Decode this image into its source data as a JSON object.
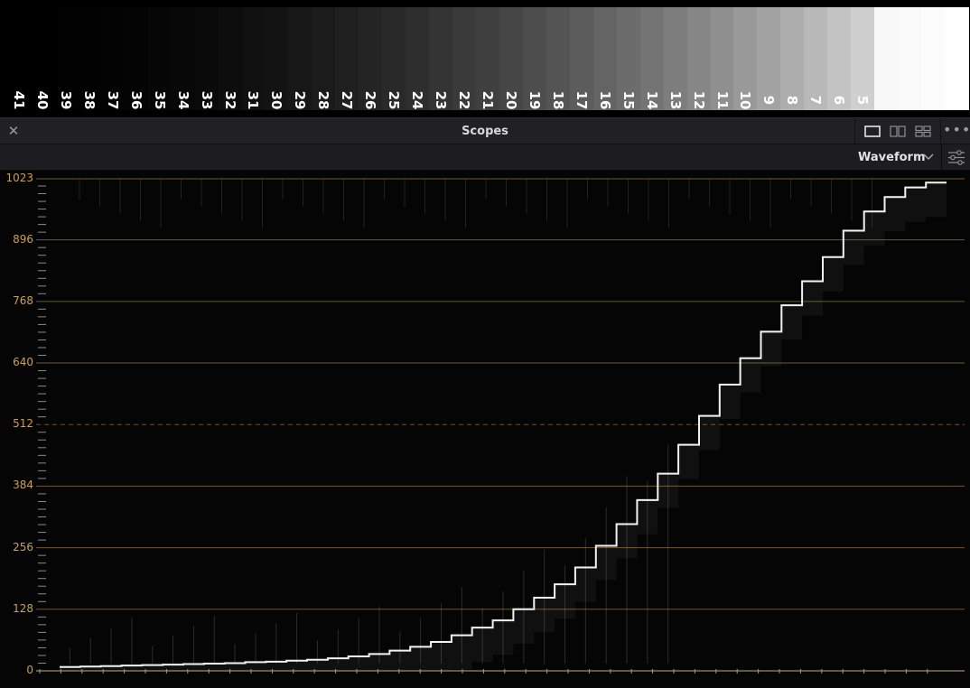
{
  "grayscale_chart": {
    "patch_numbers": [
      "41",
      "40",
      "39",
      "38",
      "37",
      "36",
      "35",
      "34",
      "33",
      "32",
      "31",
      "30",
      "29",
      "28",
      "27",
      "26",
      "25",
      "24",
      "23",
      "22",
      "21",
      "20",
      "19",
      "18",
      "17",
      "16",
      "15",
      "14",
      "13",
      "12",
      "11",
      "10",
      "9",
      "8",
      "7",
      "6",
      "5"
    ]
  },
  "scopes_panel": {
    "title": "Scopes",
    "close_icon": "close-icon",
    "layout_icons": [
      "single-view-icon",
      "dual-view-icon",
      "quad-view-icon"
    ],
    "more_icon": "more-options-icon",
    "mode": "Waveform",
    "settings_icon": "sliders-settings-icon"
  },
  "waveform": {
    "axis_labels": [
      "1023",
      "896",
      "768",
      "640",
      "512",
      "384",
      "256",
      "128",
      "0"
    ],
    "scale_max": 1023,
    "grid_color": "#6b5630",
    "label_color": "#c9a14a",
    "mid_line": "dashed",
    "step_levels": [
      8,
      9,
      10,
      11,
      12,
      13,
      14,
      15,
      16,
      18,
      19,
      21,
      23,
      26,
      30,
      35,
      42,
      50,
      60,
      74,
      90,
      105,
      128,
      152,
      180,
      215,
      260,
      305,
      355,
      410,
      470,
      530,
      595,
      650,
      705,
      760,
      810,
      860,
      915,
      955,
      985,
      1005,
      1015
    ]
  }
}
